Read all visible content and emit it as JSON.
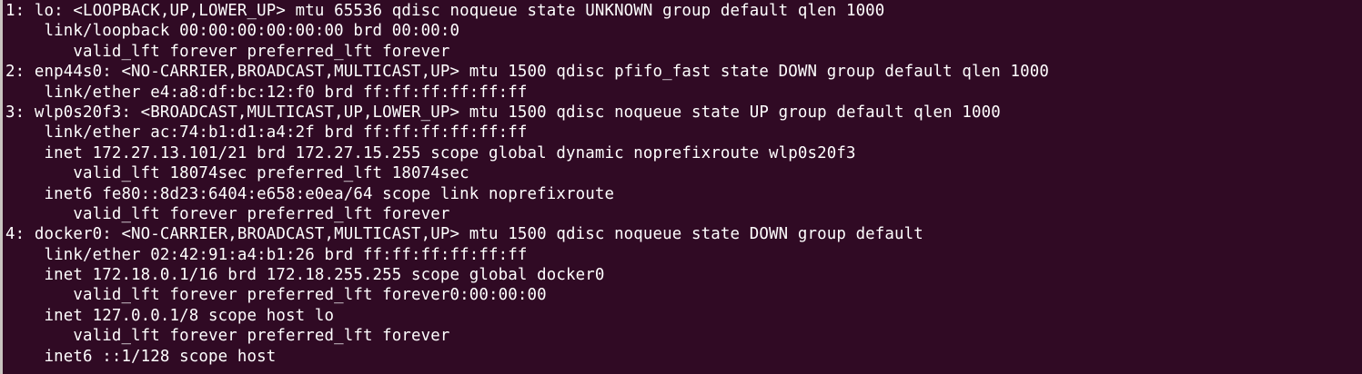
{
  "terminal": {
    "lines": [
      "1: lo: <LOOPBACK,UP,LOWER_UP> mtu 65536 qdisc noqueue state UNKNOWN group default qlen 1000",
      "    link/loopback 00:00:00:00:00:00 brd 00:00:0",
      "       valid_lft forever preferred_lft forever",
      "2: enp44s0: <NO-CARRIER,BROADCAST,MULTICAST,UP> mtu 1500 qdisc pfifo_fast state DOWN group default qlen 1000",
      "    link/ether e4:a8:df:bc:12:f0 brd ff:ff:ff:ff:ff:ff",
      "3: wlp0s20f3: <BROADCAST,MULTICAST,UP,LOWER_UP> mtu 1500 qdisc noqueue state UP group default qlen 1000",
      "    link/ether ac:74:b1:d1:a4:2f brd ff:ff:ff:ff:ff:ff",
      "    inet 172.27.13.101/21 brd 172.27.15.255 scope global dynamic noprefixroute wlp0s20f3",
      "       valid_lft 18074sec preferred_lft 18074sec",
      "    inet6 fe80::8d23:6404:e658:e0ea/64 scope link noprefixroute",
      "       valid_lft forever preferred_lft forever",
      "4: docker0: <NO-CARRIER,BROADCAST,MULTICAST,UP> mtu 1500 qdisc noqueue state DOWN group default",
      "    link/ether 02:42:91:a4:b1:26 brd ff:ff:ff:ff:ff:ff",
      "    inet 172.18.0.1/16 brd 172.18.255.255 scope global docker0",
      "       valid_lft forever preferred_lft forever0:00:00:00",
      "    inet 127.0.0.1/8 scope host lo",
      "       valid_lft forever preferred_lft forever",
      "    inet6 ::1/128 scope host"
    ]
  },
  "colors": {
    "background": "#300a24",
    "foreground": "#ffffff"
  }
}
